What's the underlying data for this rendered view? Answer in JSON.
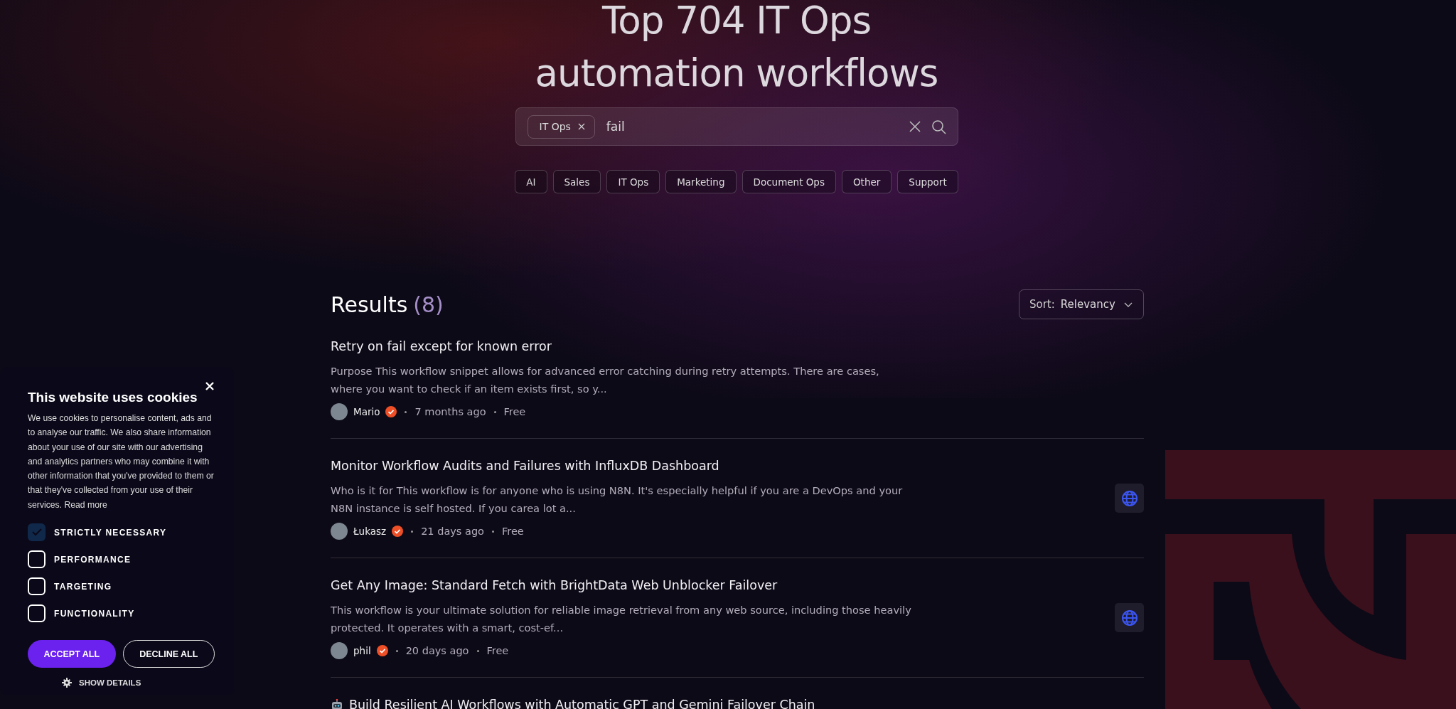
{
  "hero": {
    "title_lines": [
      "Top 704 IT Ops",
      "automation workflows"
    ]
  },
  "search": {
    "chips": [
      {
        "label": "IT Ops"
      }
    ],
    "value": "fail"
  },
  "categories": [
    {
      "label": "AI"
    },
    {
      "label": "Sales"
    },
    {
      "label": "IT Ops"
    },
    {
      "label": "Marketing"
    },
    {
      "label": "Document Ops"
    },
    {
      "label": "Other"
    },
    {
      "label": "Support"
    }
  ],
  "results": {
    "heading": "Results",
    "count": "(8)",
    "sort": {
      "label": "Sort:",
      "value": "Relevancy"
    },
    "items": [
      {
        "title": "Retry on fail except for known error",
        "description": "Purpose This workflow snippet allows for advanced error catching during retry attempts. There are cases, where you want to check if an item exists first, so y...",
        "author": "Mario",
        "verified": true,
        "time": "7 months ago",
        "price": "Free"
      },
      {
        "title": "Monitor Workflow Audits and Failures with InfluxDB Dashboard",
        "description": "Who is it for This workflow is for anyone who is using N8N. It's especially helpful if you are a DevOps and your N8N instance is self hosted. If you carea lot a...",
        "author": "Łukasz",
        "verified": true,
        "time": "21 days ago",
        "price": "Free",
        "apps": [
          {
            "kind": "globe"
          }
        ]
      },
      {
        "title": "Get Any Image: Standard Fetch with BrightData Web Unblocker Failover",
        "description": "This workflow is your ultimate solution for reliable image retrieval from any web source, including those heavily protected. It operates with a smart, cost-ef...",
        "author": "phil",
        "verified": true,
        "time": "20 days ago",
        "price": "Free",
        "apps": [
          {
            "kind": "globe"
          }
        ]
      },
      {
        "icon": {
          "kind": "robot"
        },
        "title": "Build Resilient AI Workflows with Automatic GPT and Gemini Failover Chain"
      }
    ]
  },
  "cookie_banner": {
    "title": "This website uses cookies",
    "body": "We use cookies to personalise content, ads and to analyse our traffic. We also share information about your use of our site with our advertising and analytics partners who may combine it with other information that you've provided to them or that they've collected from your use of their services.",
    "read_more": "Read more",
    "options": [
      {
        "label": "STRICTLY NECESSARY",
        "checked": true
      },
      {
        "label": "PERFORMANCE",
        "checked": false
      },
      {
        "label": "TARGETING",
        "checked": false
      },
      {
        "label": "FUNCTIONALITY",
        "checked": false
      }
    ],
    "buttons": [
      {
        "kind": "primary",
        "label": "ACCEPT ALL"
      },
      {
        "kind": "outline",
        "label": "DECLINE ALL"
      }
    ],
    "show_details": "SHOW DETAILS"
  }
}
